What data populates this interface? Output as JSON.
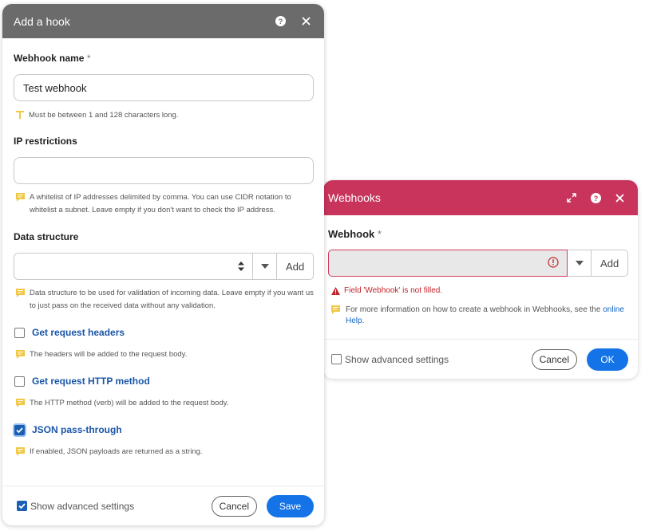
{
  "webhooks_dialog": {
    "title": "Webhooks",
    "field_label": "Webhook",
    "required_mark": "*",
    "add_label": "Add",
    "error_text": "Field 'Webhook' is not filled.",
    "info_text": "For more information on how to create a webhook in Webhooks, see the ",
    "info_link": "online Help",
    "info_suffix": ".",
    "show_advanced_label": "Show advanced settings",
    "show_advanced_checked": false,
    "cancel_label": "Cancel",
    "ok_label": "OK",
    "header_color": "#c8345c"
  },
  "hook_dialog": {
    "title": "Add a hook",
    "header_color": "#6b6b6b",
    "webhook_name": {
      "label": "Webhook name",
      "required_mark": "*",
      "value": "Test webhook",
      "hint": "Must be between 1 and 128 characters long.",
      "hint_icon": "text-icon"
    },
    "ip_restrictions": {
      "label": "IP restrictions",
      "value": "",
      "hint": "A whitelist of IP addresses delimited by comma. You can use CIDR notation to whitelist a subnet. Leave empty if you don't want to check the IP address."
    },
    "data_structure": {
      "label": "Data structure",
      "value": "",
      "add_label": "Add",
      "hint": "Data structure to be used for validation of incoming data. Leave empty if you want us to just pass on the received data without any validation."
    },
    "get_request_headers": {
      "label": "Get request headers",
      "checked": false,
      "hint": "The headers will be added to the request body."
    },
    "get_request_http_method": {
      "label": "Get request HTTP method",
      "checked": false,
      "hint": "The HTTP method (verb) will be added to the request body."
    },
    "json_pass_through": {
      "label": "JSON pass-through",
      "checked": true,
      "hint": "If enabled, JSON payloads are returned as a string."
    },
    "show_advanced_label": "Show advanced settings",
    "show_advanced_checked": true,
    "cancel_label": "Cancel",
    "save_label": "Save"
  },
  "colors": {
    "primary_button": "#1473e6",
    "error": "#c2252d",
    "note_icon": "#f2c744",
    "link": "#1565c0"
  }
}
